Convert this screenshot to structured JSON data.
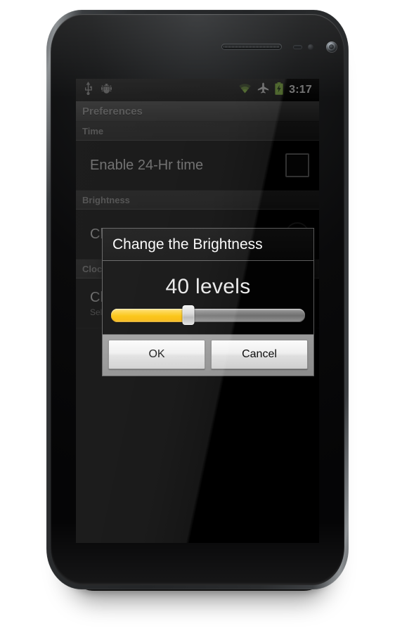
{
  "statusbar": {
    "icons_left": [
      {
        "name": "usb-icon",
        "label": "USB"
      },
      {
        "name": "android-debug-icon",
        "label": "Android Debug"
      }
    ],
    "icons_right": [
      {
        "name": "wifi-icon",
        "label": "Wi-Fi",
        "color": "#8cc63f"
      },
      {
        "name": "airplane-mode-icon",
        "label": "Airplane Mode",
        "color": "#d8d8d8"
      },
      {
        "name": "battery-charging-icon",
        "label": "Battery Charging",
        "color": "#8cc63f"
      }
    ],
    "time": "3:17"
  },
  "actionbar": {
    "title": "Preferences"
  },
  "preferences": {
    "categories": [
      {
        "header": "Time",
        "items": [
          {
            "title": "Enable 24-Hr time",
            "subtitle": "",
            "widget": "checkbox",
            "checked": false
          }
        ]
      },
      {
        "header": "Brightness",
        "items": [
          {
            "title": "Change the Brightness",
            "subtitle": "",
            "widget": "radio",
            "checked": false
          }
        ]
      },
      {
        "header": "Clock Theme",
        "items": [
          {
            "title": "Change Clock Theme",
            "subtitle": "Select a clock theme",
            "widget": "radio",
            "checked": false
          }
        ]
      }
    ]
  },
  "dialog": {
    "title": "Change the Brightness",
    "value_label": "40 levels",
    "slider": {
      "value": 40,
      "min": 0,
      "max": 100,
      "percent": 40,
      "fill_color": "#fbc000",
      "track_color": "#6f6f6f"
    },
    "buttons": [
      {
        "name": "ok-button",
        "label": "OK"
      },
      {
        "name": "cancel-button",
        "label": "Cancel"
      }
    ]
  }
}
